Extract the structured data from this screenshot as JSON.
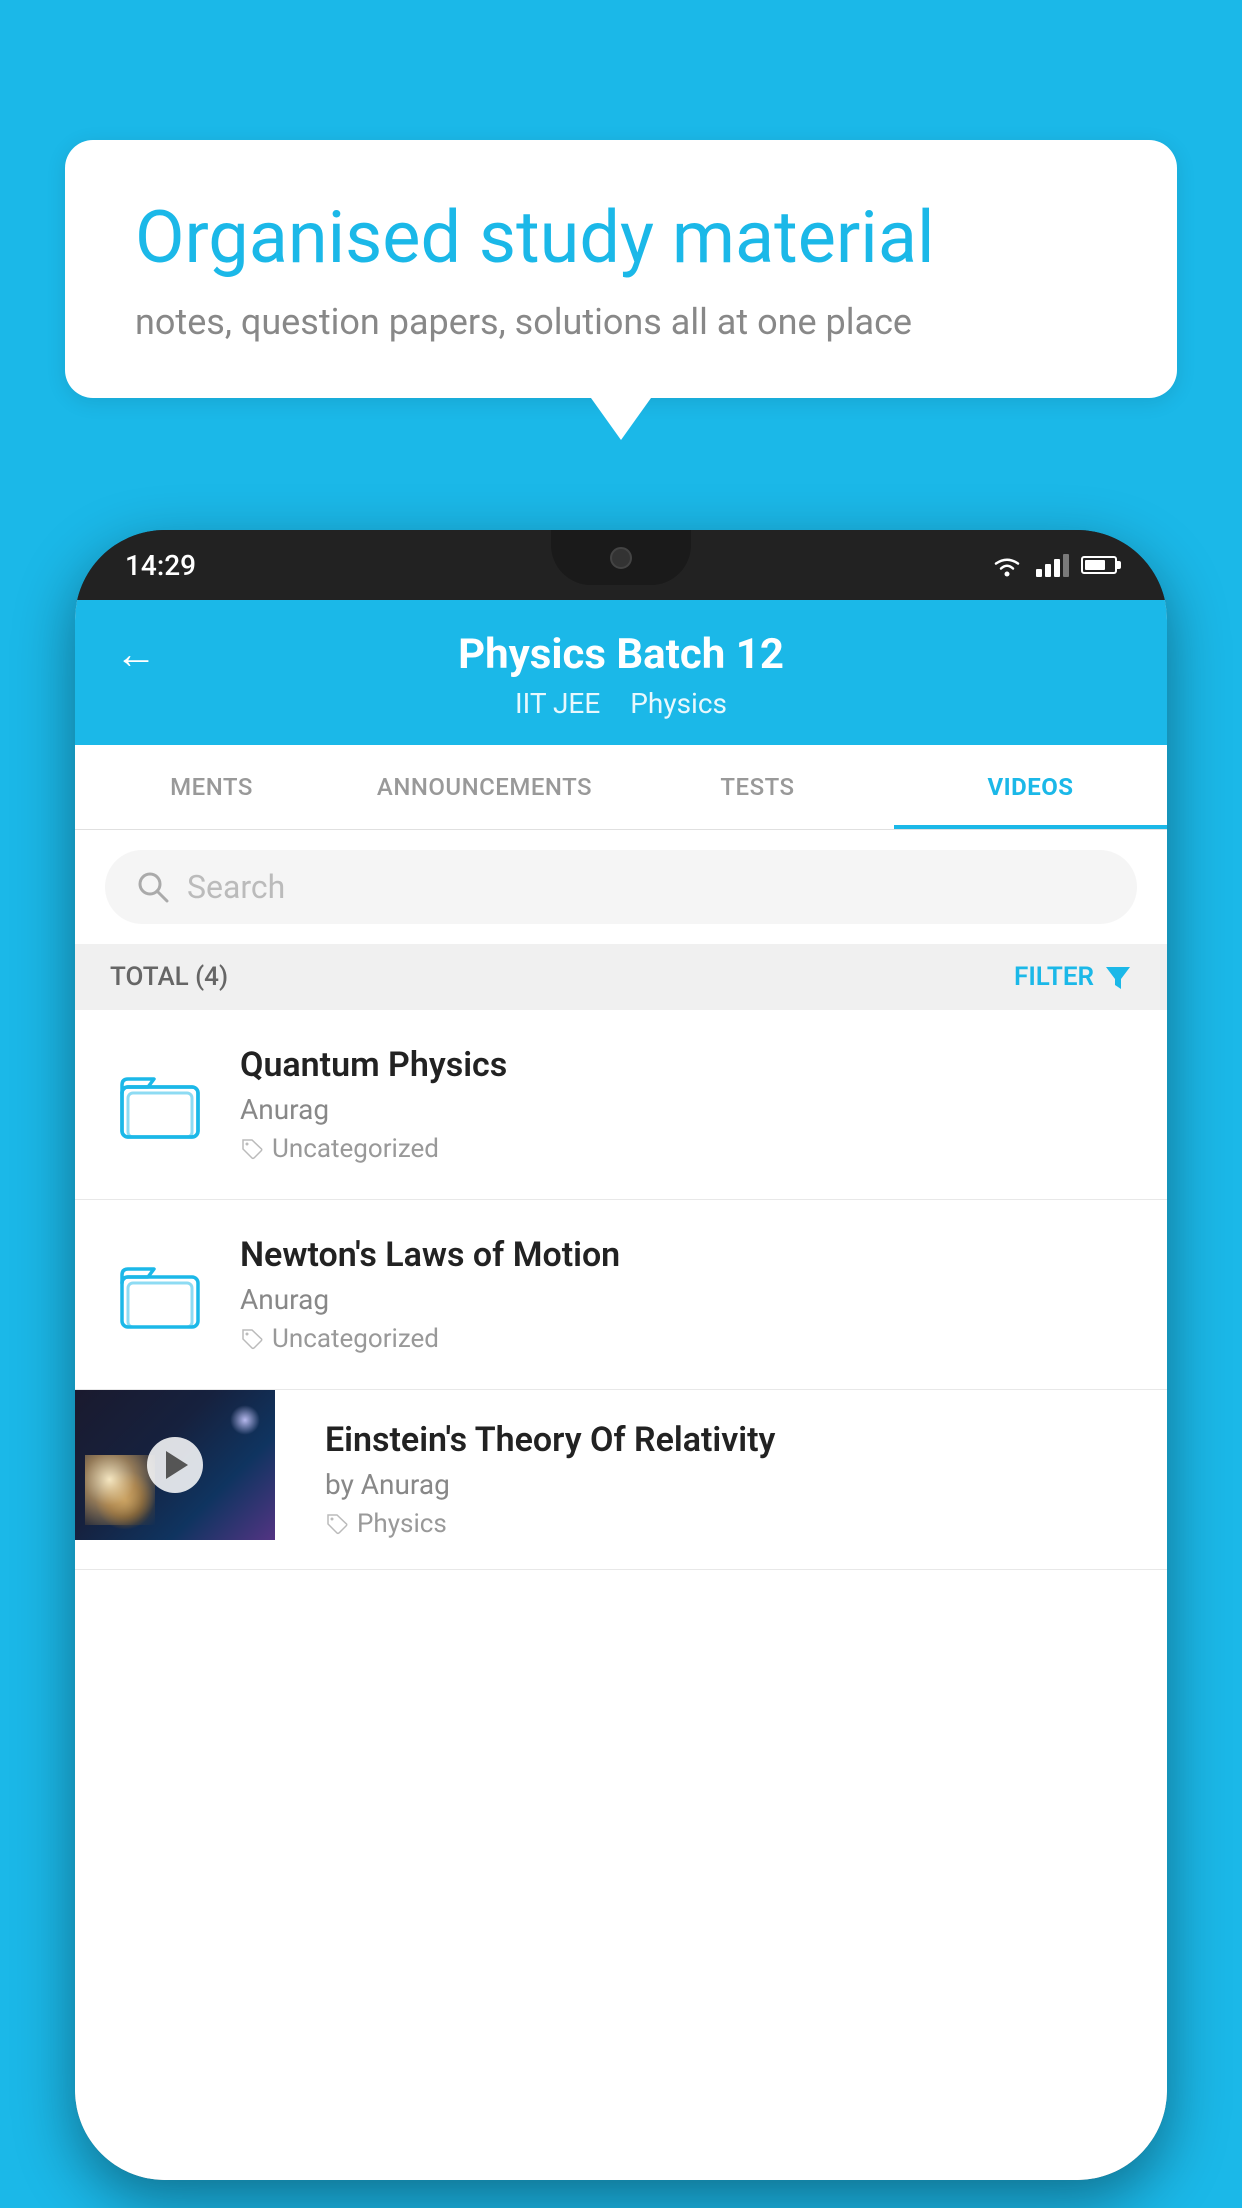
{
  "background_color": "#1BB8E8",
  "speech_bubble": {
    "title": "Organised study material",
    "subtitle": "notes, question papers, solutions all at one place"
  },
  "phone": {
    "status_bar": {
      "time": "14:29"
    },
    "header": {
      "title": "Physics Batch 12",
      "subtitle1": "IIT JEE",
      "subtitle2": "Physics",
      "back_label": "←"
    },
    "tabs": [
      {
        "label": "MENTS",
        "active": false
      },
      {
        "label": "ANNOUNCEMENTS",
        "active": false
      },
      {
        "label": "TESTS",
        "active": false
      },
      {
        "label": "VIDEOS",
        "active": true
      }
    ],
    "search": {
      "placeholder": "Search"
    },
    "filter_bar": {
      "total_label": "TOTAL (4)",
      "filter_label": "FILTER"
    },
    "videos": [
      {
        "id": 1,
        "title": "Quantum Physics",
        "author": "Anurag",
        "tag": "Uncategorized",
        "type": "folder"
      },
      {
        "id": 2,
        "title": "Newton's Laws of Motion",
        "author": "Anurag",
        "tag": "Uncategorized",
        "type": "folder"
      },
      {
        "id": 3,
        "title": "Einstein's Theory Of Relativity",
        "author": "by Anurag",
        "tag": "Physics",
        "type": "video"
      }
    ]
  }
}
